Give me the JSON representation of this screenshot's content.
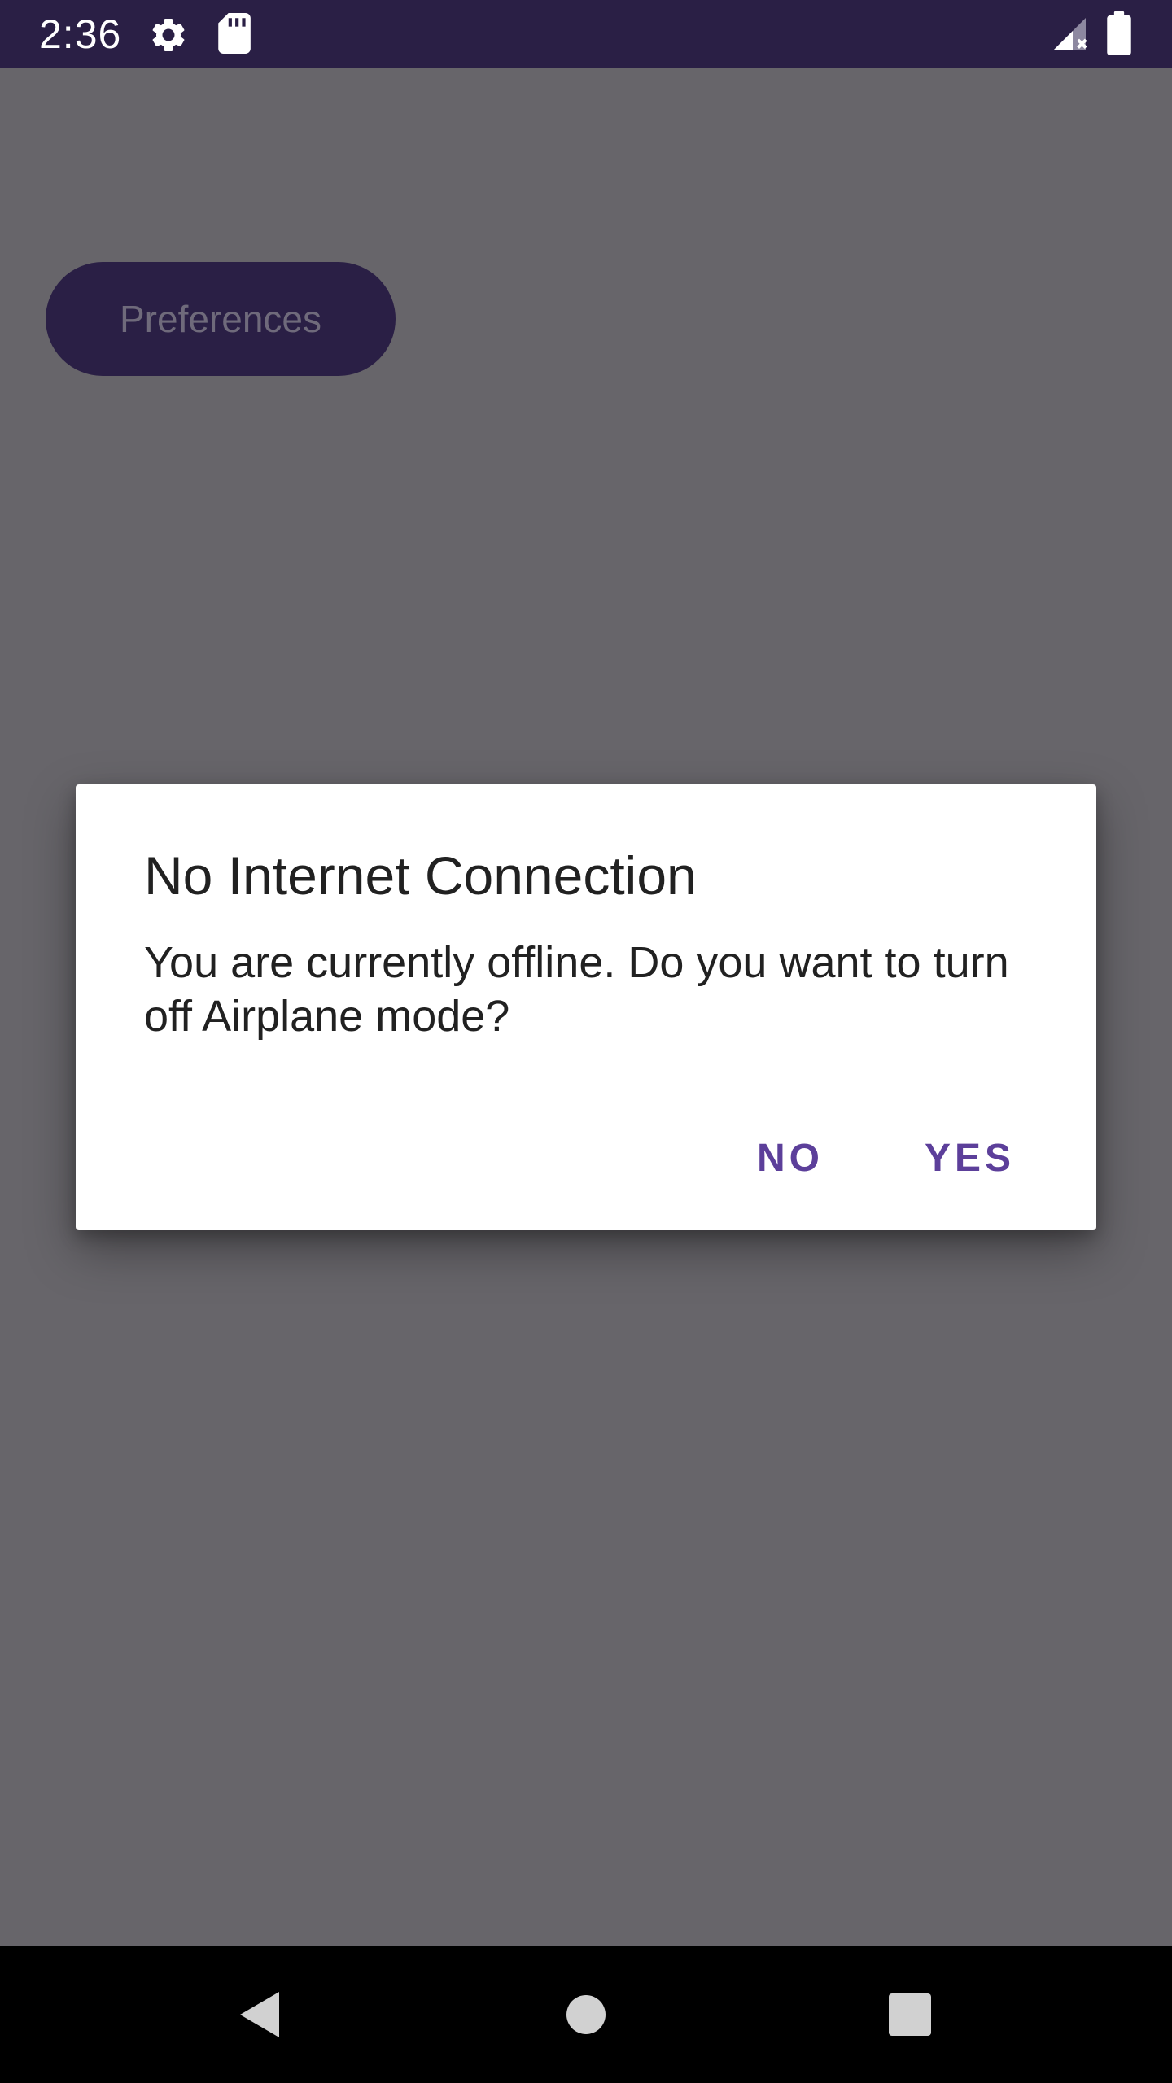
{
  "status_bar": {
    "time": "2:36",
    "icons": [
      "gear-icon",
      "sd-card-icon",
      "signal-no-data-icon",
      "battery-icon"
    ]
  },
  "main": {
    "preferences_label": "Preferences"
  },
  "dialog": {
    "title": "No Internet Connection",
    "message": "You are currently offline. Do you want to turn off Airplane mode?",
    "negative_label": "NO",
    "positive_label": "YES"
  },
  "nav_bar": {
    "icons": [
      "back-icon",
      "home-icon",
      "recents-icon"
    ]
  },
  "colors": {
    "status_bar": "#2a1f45",
    "scrim_background": "#67656a",
    "accent": "#5c3f9a",
    "dialog_background": "#ffffff"
  }
}
